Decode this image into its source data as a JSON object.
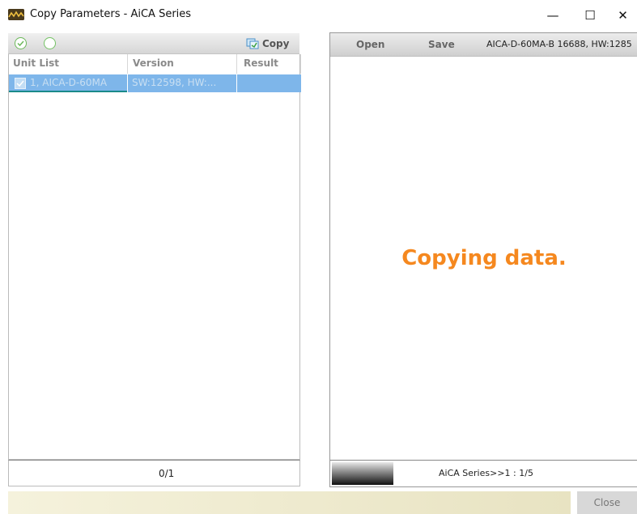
{
  "window": {
    "title": "Copy Parameters - AiCA Series",
    "controls": {
      "minimize": "—",
      "maximize": "☐",
      "close": "✕"
    }
  },
  "left_panel": {
    "toolbar": {
      "copy_label": "Copy"
    },
    "columns": [
      "Unit List",
      "Version",
      "Result"
    ],
    "rows": [
      {
        "checked": true,
        "unit": "1, AICA-D-60MA",
        "version": "SW:12598, HW:...",
        "result": ""
      }
    ],
    "count_label": "0/1"
  },
  "right_panel": {
    "toolbar": {
      "open_label": "Open",
      "save_label": "Save",
      "device_info": "AICA-D-60MA-B 16688, HW:1285"
    },
    "message": "Copying data.",
    "status_text": "AiCA Series>>1 : 1/5"
  },
  "footer": {
    "close_label": "Close"
  },
  "colors": {
    "accent_orange": "#f5881f",
    "selection_blue": "#7eb6ea",
    "check_green": "#6cb85a"
  }
}
